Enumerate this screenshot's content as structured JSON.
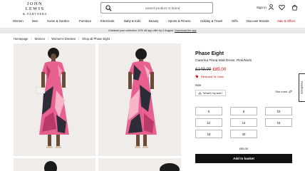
{
  "header": {
    "logo_main": "JOHN LEWIS",
    "logo_sub": "& PARTNERS",
    "search_placeholder": "Search product or brand",
    "sign_in_label": "Sign in",
    "icons": [
      "search-icon",
      "user-icon",
      "heart-icon",
      "basket-icon"
    ]
  },
  "nav": {
    "items": [
      "Women",
      "Men",
      "Home & Garden",
      "Furniture",
      "Electricals",
      "Baby & Kids",
      "Beauty",
      "Sports & Fitness",
      "Holiday & Travel",
      "Gifts",
      "Discover Brands",
      "Sale & Offers"
    ],
    "sale_color": "#c00000"
  },
  "promo": {
    "text": "Kickstart your collection 10% off app offer by 2 August. ",
    "link": "Download the app"
  },
  "breadcrumb": [
    "Homepage",
    "Women",
    "Women's Dresses",
    "Shop all Phase Eight"
  ],
  "product": {
    "brand": "Phase Eight",
    "name": "Caterina Floral Midi Dress, Pink/Multi",
    "was_price": "£149.00",
    "now_price": "£85.00",
    "reduced_label": "Reduced To Clear",
    "size_label": "Size",
    "whats_my_size": "What's my size?",
    "size_chart": "Size chart",
    "sizes": [
      "6",
      "8",
      "10",
      "12",
      "14",
      "16",
      "18",
      "20"
    ],
    "price_repeat": "£85.00",
    "add_to_basket": "Add to basket"
  },
  "feedback_label": "Feedback",
  "colors": {
    "accent": "#111111",
    "sale": "#cc0000",
    "promo_bg": "#e9e9e9",
    "dress_pink": "#e8608f"
  }
}
